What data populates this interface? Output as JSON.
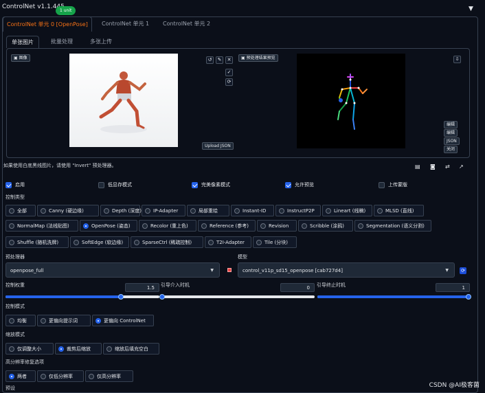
{
  "header": {
    "title": "ControlNet v1.1.445",
    "badge": "1 unit",
    "toggle": "▼"
  },
  "tabs": [
    "ControlNet 单元 0 [OpenPose]",
    "ControlNet 单元 1",
    "ControlNet 单元 2"
  ],
  "subtabs": [
    "单张图片",
    "批量处理",
    "多张上传"
  ],
  "image_panel": {
    "image_label": "图像",
    "upload_json": "Upload JSON",
    "preview_label": "预处理结果预览",
    "output_buttons": [
      "编辑",
      "编辑",
      "JSON",
      "关闭"
    ],
    "download_icon": "⇩"
  },
  "hint": "如果使用白底黑线图片，请使用 \"Invert\" 预处理器。",
  "checkboxes": [
    {
      "label": "启用",
      "checked": true
    },
    {
      "label": "低显存模式",
      "checked": false
    },
    {
      "label": "完美像素模式",
      "checked": true
    },
    {
      "label": "允许预览",
      "checked": true
    },
    {
      "label": "上传蒙版",
      "checked": false
    }
  ],
  "control_type": {
    "label": "控制类型",
    "selected": "OpenPose (姿态)",
    "row1": [
      "全部",
      "Canny (硬边缘)",
      "Depth (深度)",
      "IP-Adapter",
      "局部重绘",
      "Instant-ID",
      "InstructP2P",
      "Lineart (线稿)",
      "MLSD (直线)"
    ],
    "row2": [
      "NormalMap (法线贴图)",
      "OpenPose (姿态)",
      "Recolor (重上色)",
      "Reference (参考)",
      "Revision",
      "Scribble (涂鸦)",
      "Segmentation (语义分割)"
    ],
    "row3": [
      "Shuffle (随机洗牌)",
      "SoftEdge (软边缘)",
      "SparseCtrl (稀疏控制)",
      "T2I-Adapter",
      "Tile (分块)"
    ]
  },
  "preprocessor": {
    "label": "预处理器",
    "value": "openpose_full"
  },
  "model": {
    "label": "模型",
    "value": "control_v11p_sd15_openpose [cab727d4]"
  },
  "sliders": [
    {
      "label": "控制权重",
      "value": "1.5",
      "fraction": 0.75
    },
    {
      "label": "引导介入时机",
      "value": "0",
      "fraction": 0.0
    },
    {
      "label": "引导终止时机",
      "value": "1",
      "fraction": 1.0
    }
  ],
  "control_mode": {
    "label": "控制模式",
    "options": [
      "均衡",
      "更偏向提示词",
      "更偏向 ControlNet"
    ],
    "selected": "更偏向 ControlNet"
  },
  "resize_mode": {
    "label": "缩放模式",
    "options": [
      "仅调整大小",
      "裁剪后缩放",
      "缩放后填充空白"
    ],
    "selected": "裁剪后缩放"
  },
  "hires_fix": {
    "label": "高分辨率修复选项",
    "options": [
      "两者",
      "仅低分辨率",
      "仅高分辨率"
    ],
    "selected": "两者"
  },
  "presets_label": "预设",
  "watermark": "CSDN @AI极客菌"
}
